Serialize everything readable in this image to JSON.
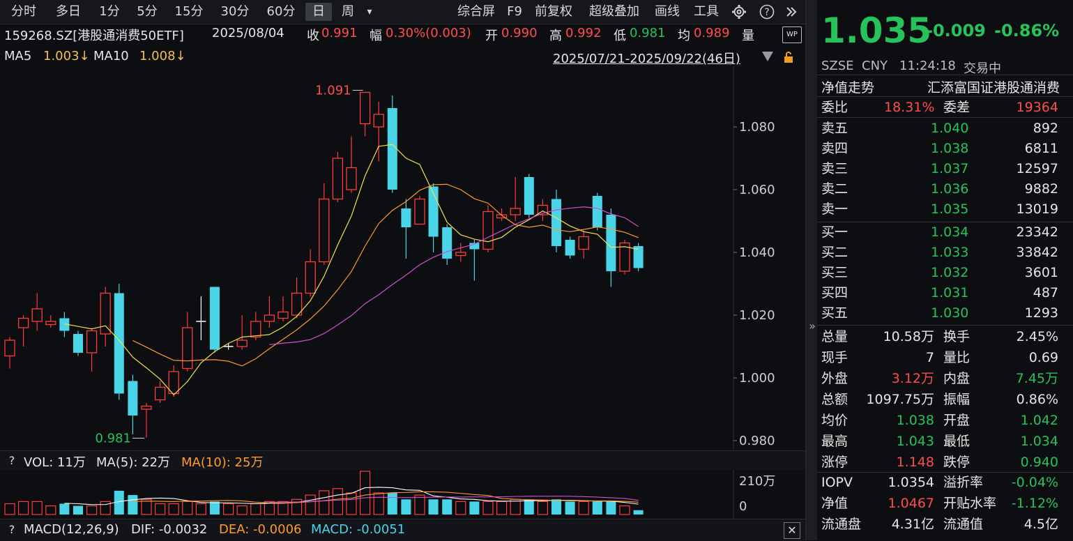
{
  "toolbar": {
    "tabs": [
      "分时",
      "多日",
      "1分",
      "5分",
      "15分",
      "30分",
      "60分",
      "日",
      "周"
    ],
    "active_tab": "日",
    "more_glyph": "▾",
    "actions": [
      "综合屏",
      "F9",
      "前复权",
      "超级叠加",
      "画线",
      "工具"
    ],
    "icons": [
      "gear-icon",
      "help-icon",
      "double-chevron-right-icon"
    ]
  },
  "stock_info": {
    "code_name": "159268.SZ[港股通消费50ETF]",
    "date": "2025/08/04",
    "close_label": "收",
    "close": "0.991",
    "change_label": "幅",
    "change": "0.30%(0.003)",
    "open_label": "开",
    "open": "0.990",
    "high_label": "高",
    "high": "0.992",
    "low_label": "低",
    "low": "0.981",
    "avg_label": "均",
    "avg": "0.989",
    "vol_label": "量"
  },
  "ma_row": {
    "ma5_label": "MA5",
    "ma5": "1.003↓",
    "ma10_label": "MA10",
    "ma10": "1.008↓",
    "range": "2025/07/21-2025/09/22(46日)"
  },
  "chart_data": {
    "type": "candlestick",
    "y_ticks": [
      "1.080",
      "1.060",
      "1.040",
      "1.020",
      "1.000",
      "0.980"
    ],
    "ylim": [
      0.978,
      1.098
    ],
    "max_label": "1.091",
    "min_label": "0.981",
    "colors": {
      "up": "#ff3b3b",
      "down": "#4ad4e8",
      "ma5": "#f5e14a",
      "ma10": "#ff9a2e",
      "ma20": "#d24fd2"
    },
    "candles": [
      {
        "o": 1.007,
        "c": 1.012,
        "h": 1.013,
        "l": 1.003
      },
      {
        "o": 1.016,
        "c": 1.019,
        "h": 1.02,
        "l": 1.01
      },
      {
        "o": 1.018,
        "c": 1.022,
        "h": 1.027,
        "l": 1.015
      },
      {
        "o": 1.017,
        "c": 1.018,
        "h": 1.02,
        "l": 1.016
      },
      {
        "o": 1.019,
        "c": 1.015,
        "h": 1.021,
        "l": 1.013
      },
      {
        "o": 1.014,
        "c": 1.008,
        "h": 1.015,
        "l": 1.007
      },
      {
        "o": 1.008,
        "c": 1.015,
        "h": 1.016,
        "l": 1.002
      },
      {
        "o": 1.014,
        "c": 1.027,
        "h": 1.029,
        "l": 1.01
      },
      {
        "o": 1.027,
        "c": 0.995,
        "h": 1.03,
        "l": 0.993
      },
      {
        "o": 0.999,
        "c": 0.988,
        "h": 1.001,
        "l": 0.982
      },
      {
        "o": 0.99,
        "c": 0.991,
        "h": 0.992,
        "l": 0.981
      },
      {
        "o": 0.993,
        "c": 0.997,
        "h": 0.999,
        "l": 0.992
      },
      {
        "o": 0.995,
        "c": 1.002,
        "h": 1.004,
        "l": 0.994
      },
      {
        "o": 1.003,
        "c": 1.016,
        "h": 1.021,
        "l": 1.002
      },
      {
        "o": 1.018,
        "c": 1.018,
        "h": 1.026,
        "l": 1.012
      },
      {
        "o": 1.029,
        "c": 1.009,
        "h": 1.029,
        "l": 1.008
      },
      {
        "o": 1.01,
        "c": 1.01,
        "h": 1.011,
        "l": 1.009
      },
      {
        "o": 1.01,
        "c": 1.012,
        "h": 1.02,
        "l": 1.009
      },
      {
        "o": 1.013,
        "c": 1.018,
        "h": 1.021,
        "l": 1.012
      },
      {
        "o": 1.018,
        "c": 1.02,
        "h": 1.026,
        "l": 1.016
      },
      {
        "o": 1.019,
        "c": 1.021,
        "h": 1.026,
        "l": 1.018
      },
      {
        "o": 1.02,
        "c": 1.027,
        "h": 1.032,
        "l": 1.019
      },
      {
        "o": 1.027,
        "c": 1.037,
        "h": 1.041,
        "l": 1.026
      },
      {
        "o": 1.037,
        "c": 1.057,
        "h": 1.062,
        "l": 1.036
      },
      {
        "o": 1.057,
        "c": 1.07,
        "h": 1.072,
        "l": 1.056
      },
      {
        "o": 1.06,
        "c": 1.067,
        "h": 1.077,
        "l": 1.059
      },
      {
        "o": 1.081,
        "c": 1.091,
        "h": 1.091,
        "l": 1.077
      },
      {
        "o": 1.08,
        "c": 1.084,
        "h": 1.088,
        "l": 1.069
      },
      {
        "o": 1.086,
        "c": 1.06,
        "h": 1.09,
        "l": 1.059
      },
      {
        "o": 1.054,
        "c": 1.048,
        "h": 1.057,
        "l": 1.038
      },
      {
        "o": 1.049,
        "c": 1.057,
        "h": 1.058,
        "l": 1.05
      },
      {
        "o": 1.061,
        "c": 1.045,
        "h": 1.062,
        "l": 1.04
      },
      {
        "o": 1.048,
        "c": 1.038,
        "h": 1.049,
        "l": 1.036
      },
      {
        "o": 1.039,
        "c": 1.04,
        "h": 1.043,
        "l": 1.037
      },
      {
        "o": 1.043,
        "c": 1.041,
        "h": 1.044,
        "l": 1.031
      },
      {
        "o": 1.041,
        "c": 1.053,
        "h": 1.055,
        "l": 1.04
      },
      {
        "o": 1.051,
        "c": 1.052,
        "h": 1.054,
        "l": 1.05
      },
      {
        "o": 1.052,
        "c": 1.054,
        "h": 1.064,
        "l": 1.05
      },
      {
        "o": 1.064,
        "c": 1.052,
        "h": 1.065,
        "l": 1.051
      },
      {
        "o": 1.052,
        "c": 1.055,
        "h": 1.057,
        "l": 1.05
      },
      {
        "o": 1.057,
        "c": 1.042,
        "h": 1.06,
        "l": 1.04
      },
      {
        "o": 1.044,
        "c": 1.039,
        "h": 1.045,
        "l": 1.038
      },
      {
        "o": 1.041,
        "c": 1.045,
        "h": 1.047,
        "l": 1.038
      },
      {
        "o": 1.058,
        "c": 1.048,
        "h": 1.059,
        "l": 1.047
      },
      {
        "o": 1.052,
        "c": 1.034,
        "h": 1.054,
        "l": 1.029
      },
      {
        "o": 1.034,
        "c": 1.043,
        "h": 1.044,
        "l": 1.033
      },
      {
        "o": 1.042,
        "c": 1.035,
        "h": 1.043,
        "l": 1.034
      }
    ],
    "volumes": [
      0.25,
      0.3,
      0.3,
      0.2,
      0.25,
      0.2,
      0.2,
      0.3,
      0.55,
      0.45,
      0.35,
      0.25,
      0.25,
      0.3,
      0.25,
      0.3,
      0.25,
      0.2,
      0.25,
      0.3,
      0.3,
      0.35,
      0.45,
      0.55,
      0.6,
      0.5,
      1.0,
      0.5,
      0.5,
      0.35,
      0.45,
      0.35,
      0.35,
      0.3,
      0.3,
      0.3,
      0.3,
      0.35,
      0.35,
      0.3,
      0.35,
      0.3,
      0.3,
      0.3,
      0.3,
      0.2,
      0.1
    ]
  },
  "vol_info": {
    "help": "?",
    "vol_label": "VOL: 11万",
    "ma5_label": "MA(5): 22万",
    "ma10_label": "MA(10): 25万",
    "top_tick": "210万",
    "zero_tick": "0"
  },
  "macd_info": {
    "help": "?",
    "title": "MACD(12,26,9)",
    "dif": "DIF: -0.0032",
    "dea": "DEA: -0.0006",
    "macd": "MACD: -0.0051",
    "close_glyph": "✕"
  },
  "quote": {
    "price": "1.035",
    "change": "-0.009",
    "change_pct": "-0.86%",
    "exchange": "SZSE",
    "currency": "CNY",
    "time": "11:24:18",
    "status": "交易中",
    "nav_trend_label": "净值走势",
    "fund_name": "汇添富国证港股通消费",
    "weibi_label": "委比",
    "weibi": "18.31%",
    "weicha_label": "委差",
    "weicha": "19364",
    "asks": [
      {
        "label": "卖五",
        "price": "1.040",
        "vol": "892"
      },
      {
        "label": "卖四",
        "price": "1.038",
        "vol": "6811"
      },
      {
        "label": "卖三",
        "price": "1.037",
        "vol": "12597"
      },
      {
        "label": "卖二",
        "price": "1.036",
        "vol": "9882"
      },
      {
        "label": "卖一",
        "price": "1.035",
        "vol": "13019"
      }
    ],
    "bids": [
      {
        "label": "买一",
        "price": "1.034",
        "vol": "23342"
      },
      {
        "label": "买二",
        "price": "1.033",
        "vol": "33842"
      },
      {
        "label": "买三",
        "price": "1.032",
        "vol": "3601"
      },
      {
        "label": "买四",
        "price": "1.031",
        "vol": "487"
      },
      {
        "label": "买五",
        "price": "1.030",
        "vol": "1293"
      }
    ],
    "stats": [
      {
        "l1": "总量",
        "v1": "10.58万",
        "c1": "white",
        "l2": "换手",
        "v2": "2.45%",
        "c2": "white"
      },
      {
        "l1": "现手",
        "v1": "7",
        "c1": "white",
        "l2": "量比",
        "v2": "0.69",
        "c2": "white"
      },
      {
        "l1": "外盘",
        "v1": "3.12万",
        "c1": "red",
        "l2": "内盘",
        "v2": "7.45万",
        "c2": "green"
      },
      {
        "l1": "总额",
        "v1": "1097.75万",
        "c1": "white",
        "l2": "振幅",
        "v2": "0.86%",
        "c2": "white"
      },
      {
        "l1": "均价",
        "v1": "1.038",
        "c1": "green",
        "l2": "开盘",
        "v2": "1.042",
        "c2": "green"
      },
      {
        "l1": "最高",
        "v1": "1.043",
        "c1": "green",
        "l2": "最低",
        "v2": "1.034",
        "c2": "green"
      },
      {
        "l1": "涨停",
        "v1": "1.148",
        "c1": "red",
        "l2": "跌停",
        "v2": "0.940",
        "c2": "green"
      }
    ],
    "stats2": [
      {
        "l1": "IOPV",
        "v1": "1.0354",
        "c1": "white",
        "l2": "溢折率",
        "v2": "-0.04%",
        "c2": "green"
      },
      {
        "l1": "净值",
        "v1": "1.0467",
        "c1": "red",
        "l2": "开贴水率",
        "v2": "-1.12%",
        "c2": "green"
      },
      {
        "l1": "流通盘",
        "v1": "4.31亿",
        "c1": "white",
        "l2": "流通值",
        "v2": "4.5亿",
        "c2": "white"
      }
    ]
  },
  "side_toggle": "»"
}
